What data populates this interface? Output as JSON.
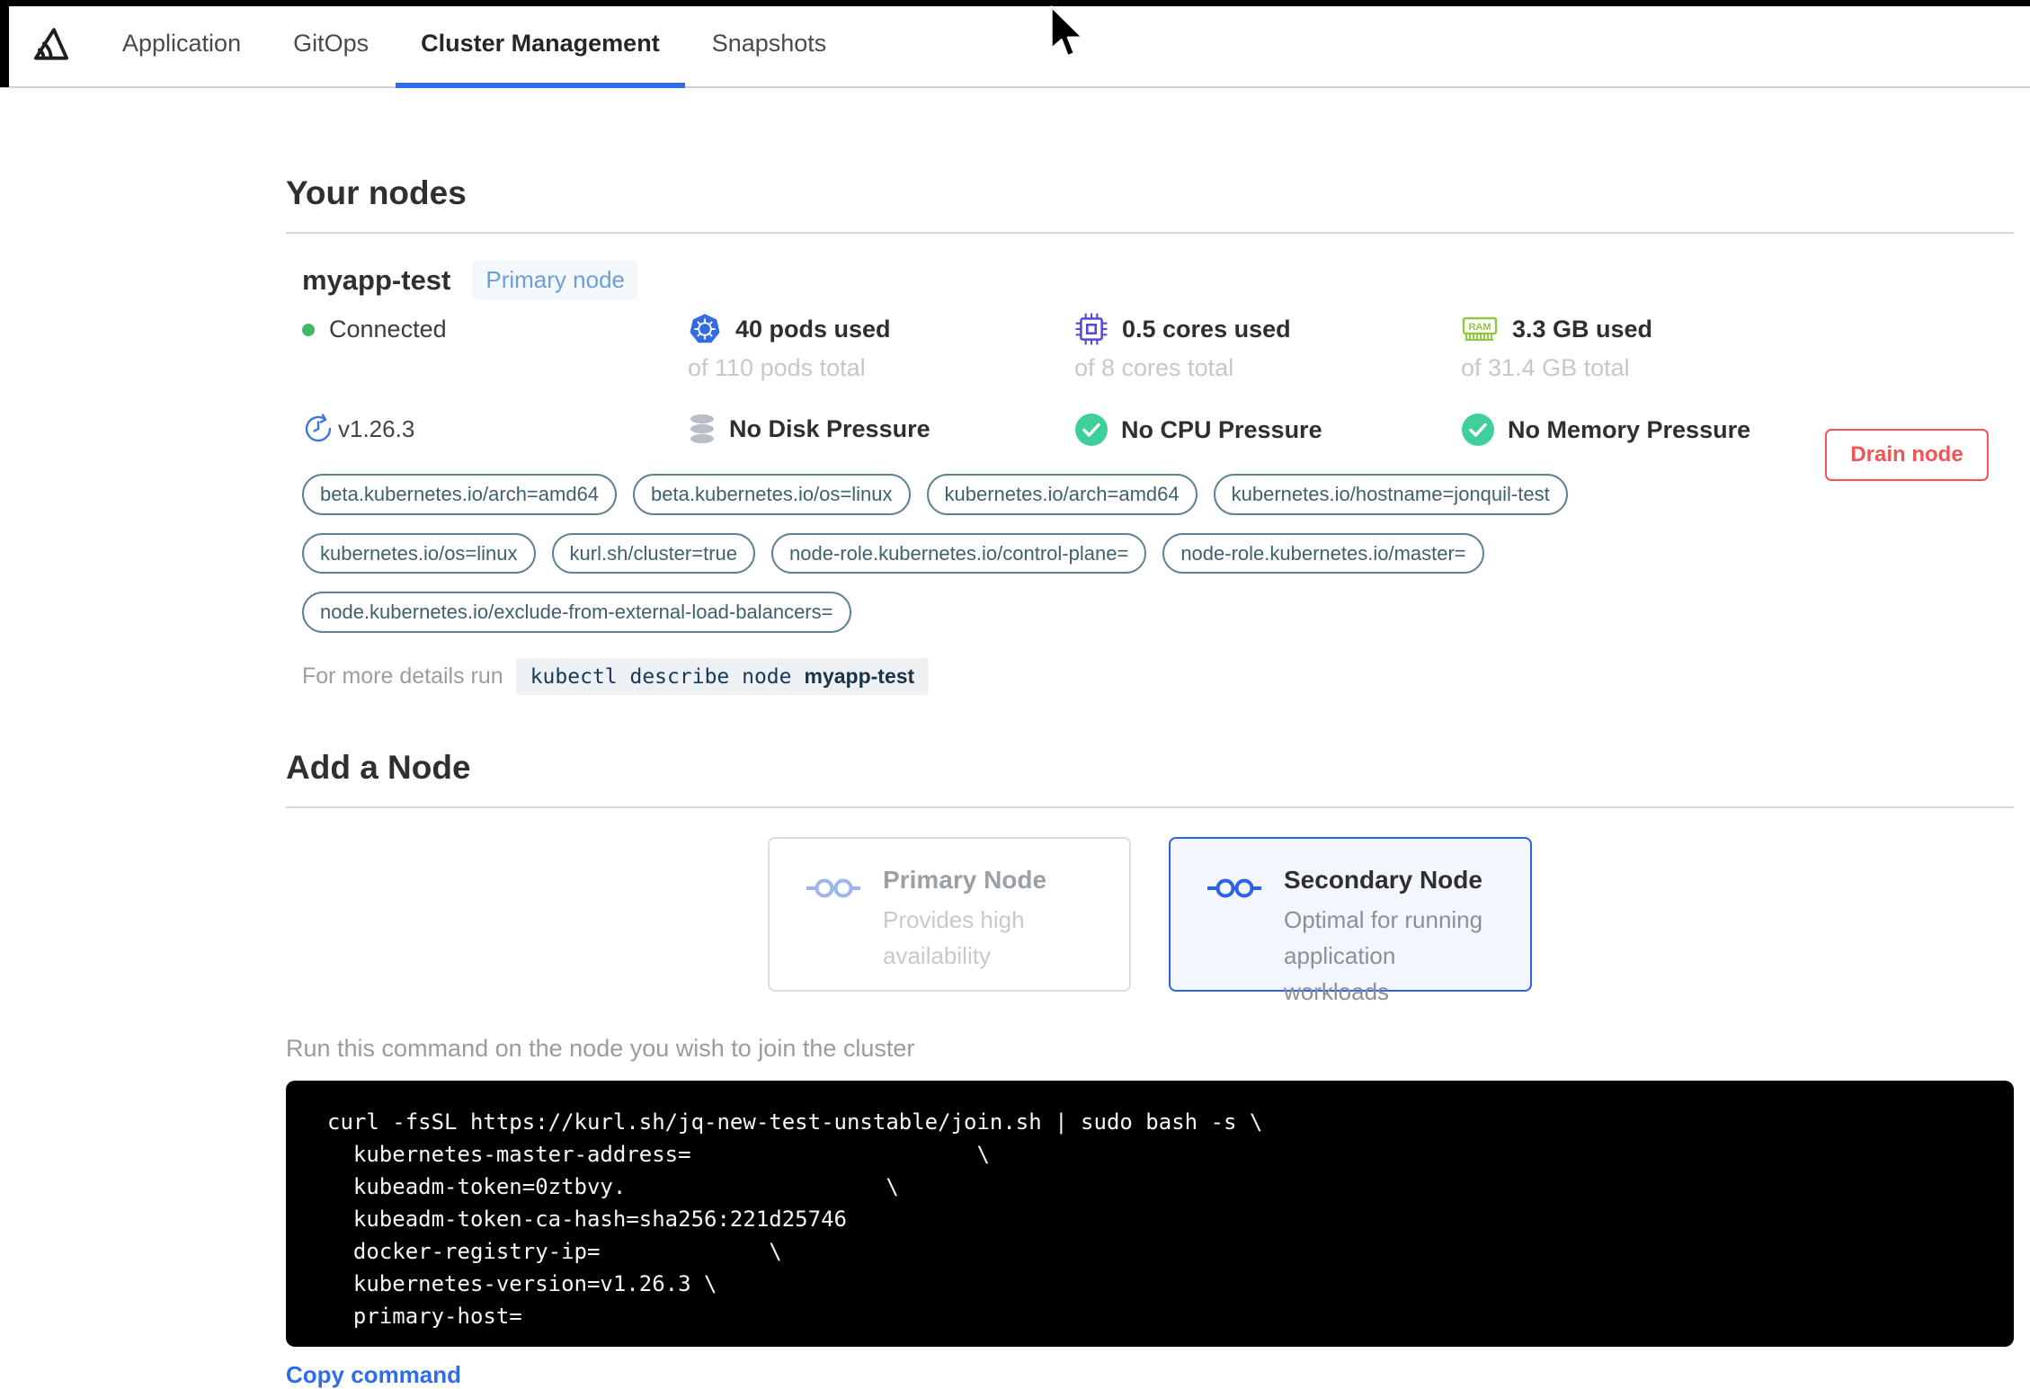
{
  "nav": {
    "tabs": [
      {
        "label": "Application"
      },
      {
        "label": "GitOps"
      },
      {
        "label": "Cluster Management"
      },
      {
        "label": "Snapshots"
      }
    ]
  },
  "your_nodes": {
    "title": "Your nodes",
    "node": {
      "name": "myapp-test",
      "badge": "Primary node",
      "status": "Connected",
      "version": "v1.26.3",
      "stats": [
        {
          "used": "40 pods used",
          "total": "of 110 pods total"
        },
        {
          "used": "0.5 cores used",
          "total": "of 8 cores total"
        },
        {
          "used": "3.3 GB used",
          "total": "of 31.4 GB total"
        }
      ],
      "conditions": [
        {
          "label": "No Disk Pressure"
        },
        {
          "label": "No CPU Pressure"
        },
        {
          "label": "No Memory Pressure"
        }
      ],
      "labels": [
        "beta.kubernetes.io/arch=amd64",
        "beta.kubernetes.io/os=linux",
        "kubernetes.io/arch=amd64",
        "kubernetes.io/hostname=jonquil-test",
        "kubernetes.io/os=linux",
        "kurl.sh/cluster=true",
        "node-role.kubernetes.io/control-plane=",
        "node-role.kubernetes.io/master=",
        "node.kubernetes.io/exclude-from-external-load-balancers="
      ],
      "details_prefix": "For more details run",
      "details_command": "kubectl describe node",
      "details_node": "myapp-test",
      "drain_button": "Drain node"
    }
  },
  "add_node": {
    "title": "Add a Node",
    "options": [
      {
        "title": "Primary Node",
        "description": "Provides high availability"
      },
      {
        "title": "Secondary Node",
        "description": "Optimal for running application workloads"
      }
    ],
    "command_label": "Run this command on the node you wish to join the cluster",
    "command_lines": [
      "curl -fsSL https://kurl.sh/jq-new-test-unstable/join.sh | sudo bash -s \\",
      "  kubernetes-master-address=                      \\",
      "  kubeadm-token=0ztbvy.                    \\",
      "  kubeadm-token-ca-hash=sha256:221d25746",
      "  docker-registry-ip=             \\",
      "  kubernetes-version=v1.26.3 \\",
      "  primary-host="
    ],
    "copy_link": "Copy command"
  },
  "colors": {
    "accent-blue": "#326de6",
    "k8s-blue": "#326ce5",
    "badge-text": "#6d9ed6",
    "badge-bg": "#f3f8fd",
    "green-dot": "#42b865",
    "check-green": "#3ecf9a",
    "ram-green": "#8fc742",
    "cpu-purple": "#5449d8",
    "disk-gray": "#b9bfc6",
    "version-blue": "#3b76dd",
    "pill-border": "#5d8290",
    "pill-text": "#3f606d",
    "red": "#f25555",
    "link-blue": "#2e6de4",
    "code-chip-navy": "#14395c",
    "card-blue": "#2c63e5",
    "node-icon-light": "#9db4ee"
  }
}
